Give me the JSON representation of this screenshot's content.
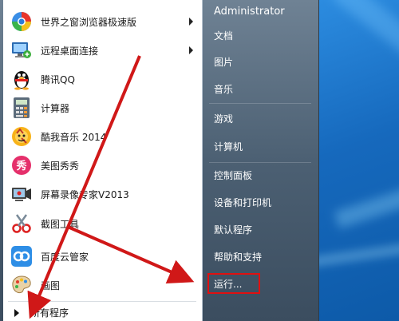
{
  "programs": [
    {
      "label": "世界之窗浏览器极速版",
      "icon": "browser-globe-icon",
      "has_submenu": true
    },
    {
      "label": "远程桌面连接",
      "icon": "remote-desktop-icon",
      "has_submenu": true
    },
    {
      "label": "腾讯QQ",
      "icon": "qq-penguin-icon",
      "has_submenu": false
    },
    {
      "label": "计算器",
      "icon": "calculator-icon",
      "has_submenu": false
    },
    {
      "label": "酷我音乐 2014",
      "icon": "kuwo-music-icon",
      "has_submenu": false
    },
    {
      "label": "美图秀秀",
      "icon": "meitu-icon",
      "has_submenu": false
    },
    {
      "label": "屏幕录像专家V2013",
      "icon": "screen-recorder-icon",
      "has_submenu": false
    },
    {
      "label": "截图工具",
      "icon": "snipping-tool-icon",
      "has_submenu": false
    },
    {
      "label": "百度云管家",
      "icon": "baidu-cloud-icon",
      "has_submenu": false
    },
    {
      "label": "画图",
      "icon": "paint-palette-icon",
      "has_submenu": false
    }
  ],
  "all_programs_label": "所有程序",
  "right_panel": {
    "user": "Administrator",
    "items": [
      "文档",
      "图片",
      "音乐",
      "游戏",
      "计算机",
      "控制面板",
      "设备和打印机",
      "默认程序",
      "帮助和支持",
      "运行..."
    ]
  },
  "colors": {
    "highlight_box": "#e01010",
    "annotation_arrow": "#d01818",
    "right_panel_text": "#ffffff"
  }
}
